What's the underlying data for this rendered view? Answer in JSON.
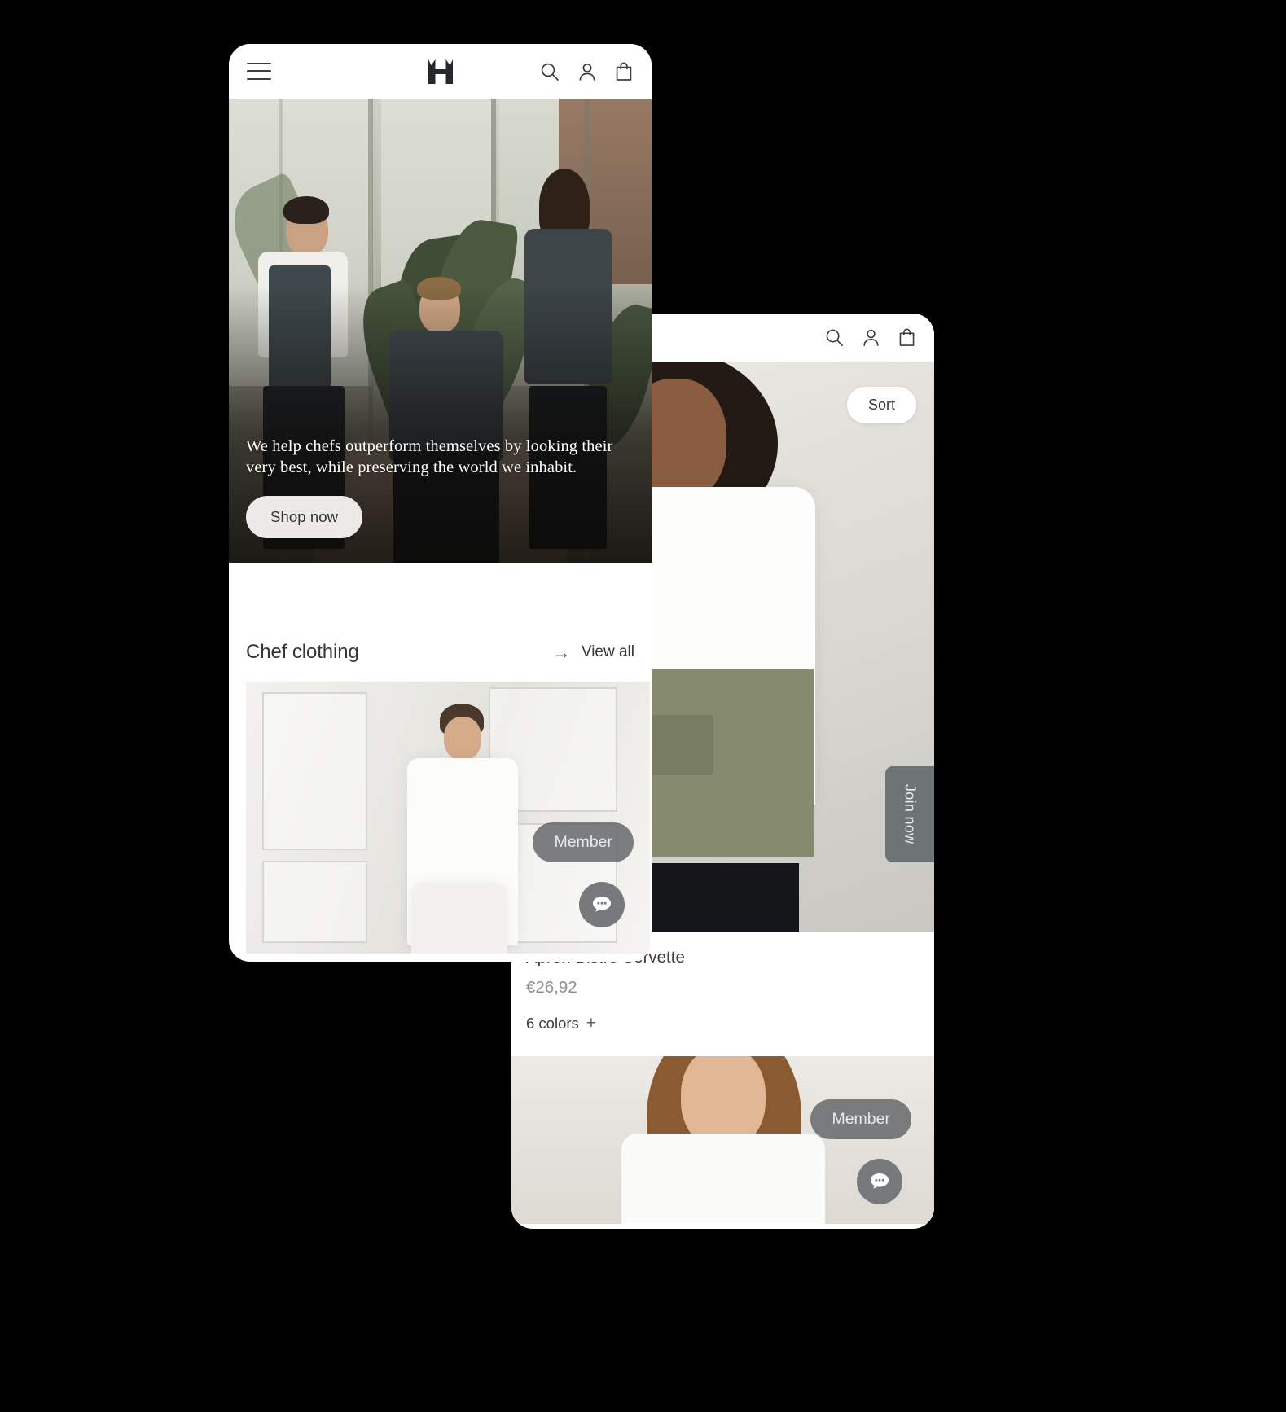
{
  "phone1": {
    "header": {
      "menu_icon": "hamburger-menu-icon",
      "logo": "brand-logo-h",
      "search_icon": "search-icon",
      "account_icon": "account-icon",
      "bag_icon": "shopping-bag-icon"
    },
    "hero": {
      "tagline": "We help chefs outperform themselves by looking their very best, while preserving the world we inhabit.",
      "cta_label": "Shop now"
    },
    "section": {
      "title": "Chef clothing",
      "view_all_label": "View all",
      "arrow_icon": "arrow-right-icon"
    },
    "product_card": {
      "member_badge": "Member",
      "chat_icon": "chat-bubble-icon"
    }
  },
  "phone2": {
    "header": {
      "logo": "brand-logo-h",
      "search_icon": "search-icon",
      "account_icon": "account-icon",
      "bag_icon": "shopping-bag-icon"
    },
    "sort_label": "Sort",
    "join_label": "Join now",
    "product": {
      "title": "Apron Bistro Servette",
      "price": "€26,92",
      "colors_label": "6 colors",
      "colors_plus": "+"
    },
    "product_card_2": {
      "member_badge": "Member",
      "chat_icon": "chat-bubble-icon"
    }
  },
  "colors": {
    "background": "#000000",
    "surface": "#ffffff",
    "text_dark": "#33363a",
    "text_muted": "#8c9094",
    "badge_gray": "#606366",
    "fab_gray": "#767a7d",
    "join_tab": "#6e7376",
    "cta_bg": "#ebeae7"
  }
}
